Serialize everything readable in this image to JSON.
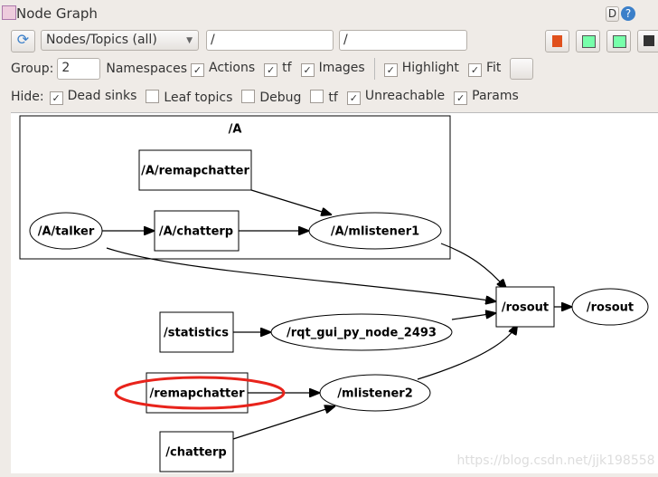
{
  "window": {
    "title": "Node Graph",
    "help_d": "D",
    "help_q": "?"
  },
  "toolbar": {
    "mode": "Nodes/Topics (all)",
    "filter1": "/",
    "filter2": "/"
  },
  "options": {
    "group_label": "Group:",
    "group_value": "2",
    "namespaces": "Namespaces",
    "actions": "Actions",
    "tf": "tf",
    "images": "Images",
    "highlight": "Highlight",
    "fit": "Fit",
    "checked": {
      "actions": true,
      "tf": true,
      "images": true,
      "highlight": true,
      "fit": true
    }
  },
  "hide": {
    "label": "Hide:",
    "dead_sinks": "Dead sinks",
    "leaf_topics": "Leaf topics",
    "debug": "Debug",
    "tf": "tf",
    "unreachable": "Unreachable",
    "params": "Params",
    "checked": {
      "dead_sinks": true,
      "leaf_topics": false,
      "debug": false,
      "tf": false,
      "unreachable": true,
      "params": true
    }
  },
  "graph": {
    "namespace": "/A",
    "nodes": {
      "a_remapchatter": "/A/remapchatter",
      "a_talker": "/A/talker",
      "a_chatterp": "/A/chatterp",
      "a_mlistener1": "/A/mlistener1",
      "rosout_node": "/rosout",
      "rosout_topic": "/rosout",
      "statistics": "/statistics",
      "rqt": "/rqt_gui_py_node_2493",
      "remapchatter": "/remapchatter",
      "mlistener2": "/mlistener2",
      "chatterp": "/chatterp"
    },
    "highlight_color": "#e8231b"
  },
  "watermark": "https://blog.csdn.net/jjk198558"
}
